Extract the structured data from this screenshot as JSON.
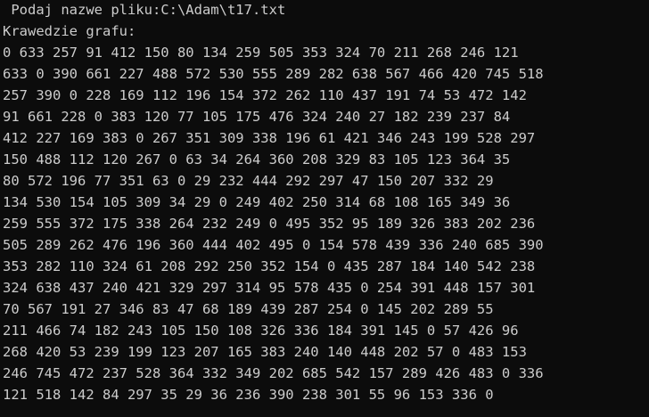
{
  "console": {
    "prompt_line": " Podaj nazwe pliku:C:\\Adam\\t17.txt",
    "heading": "Krawedzie grafu:",
    "matrix_rows": [
      "0 633 257 91 412 150 80 134 259 505 353 324 70 211 268 246 121",
      "633 0 390 661 227 488 572 530 555 289 282 638 567 466 420 745 518",
      "257 390 0 228 169 112 196 154 372 262 110 437 191 74 53 472 142",
      "91 661 228 0 383 120 77 105 175 476 324 240 27 182 239 237 84",
      "412 227 169 383 0 267 351 309 338 196 61 421 346 243 199 528 297",
      "150 488 112 120 267 0 63 34 264 360 208 329 83 105 123 364 35",
      "80 572 196 77 351 63 0 29 232 444 292 297 47 150 207 332 29",
      "134 530 154 105 309 34 29 0 249 402 250 314 68 108 165 349 36",
      "259 555 372 175 338 264 232 249 0 495 352 95 189 326 383 202 236",
      "505 289 262 476 196 360 444 402 495 0 154 578 439 336 240 685 390",
      "353 282 110 324 61 208 292 250 352 154 0 435 287 184 140 542 238",
      "324 638 437 240 421 329 297 314 95 578 435 0 254 391 448 157 301",
      "70 567 191 27 346 83 47 68 189 439 287 254 0 145 202 289 55",
      "211 466 74 182 243 105 150 108 326 336 184 391 145 0 57 426 96",
      "268 420 53 239 199 123 207 165 383 240 140 448 202 57 0 483 153",
      "246 745 472 237 528 364 332 349 202 685 542 157 289 426 483 0 336",
      "121 518 142 84 297 35 29 36 236 390 238 301 55 96 153 336 0"
    ],
    "text_color": "#cccccc",
    "background_color": "#0c0c0c"
  }
}
